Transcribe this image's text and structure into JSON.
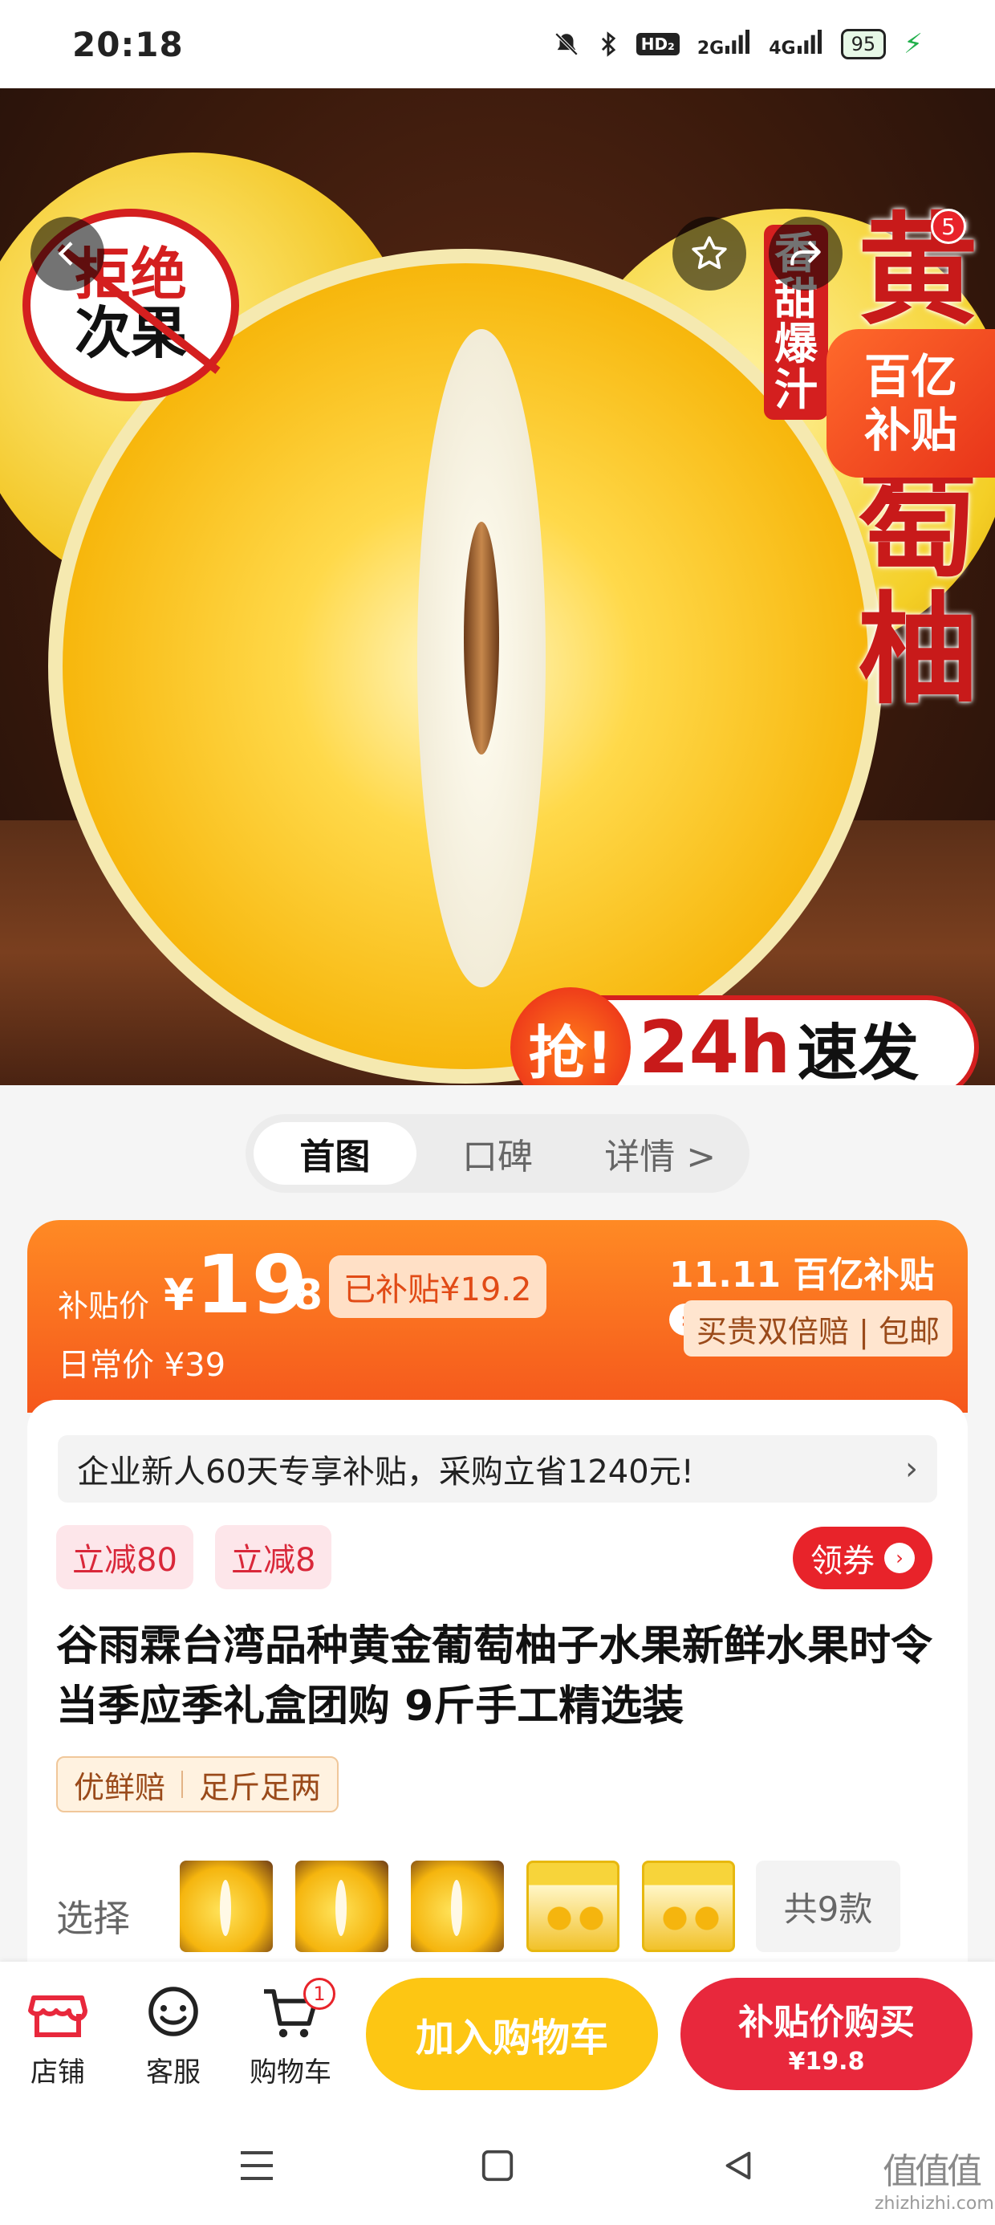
{
  "status_bar": {
    "time": "20:18",
    "hd": "HD₂",
    "sig1": "2G",
    "sig2": "4G",
    "battery": "95"
  },
  "hero": {
    "stamp_line1": "拒绝",
    "stamp_line2": "次果",
    "vertical_red": "香甜爆汁",
    "vertical_big": "黄葡萄柚",
    "yi_line1": "百亿",
    "yi_line2": "补贴",
    "speed_qiang": "抢!",
    "speed_24h": "24h",
    "speed_fa": "速发",
    "share_badge": "5"
  },
  "tabs": [
    "首图",
    "口碑",
    "详情 >"
  ],
  "price": {
    "label": "补贴价",
    "yen": "¥",
    "integer": "19",
    "decimal": ".8",
    "subsidy_chip": "已补贴¥19.2",
    "daily": "日常价 ¥39",
    "brand": "11.11 百亿补贴",
    "double": "买贵双倍赔 | 包邮"
  },
  "notice": "企业新人60天专享补贴，采购立省1240元!",
  "coupons": [
    "立减80",
    "立减8"
  ],
  "get_coupon": "领券",
  "title": "谷雨霖台湾品种黄金葡萄柚子水果新鲜水果时令当季应季礼盒团购 9斤手工精选装",
  "guarantee": [
    "优鲜赔",
    "足斤足两"
  ],
  "select": {
    "label": "选择",
    "more": "共9款"
  },
  "action_bar": {
    "shop": "店铺",
    "service": "客服",
    "cart": "购物车",
    "cart_count": "1",
    "add_cart": "加入购物车",
    "buy_line1": "补贴价购买",
    "buy_line2": "¥19.8"
  },
  "watermark": {
    "mark": "值值值",
    "url": "zhizhizhi.com"
  },
  "colors": {
    "accent_orange": "#f5571c",
    "accent_red": "#e8232a",
    "cart_yellow": "#fdc613"
  }
}
